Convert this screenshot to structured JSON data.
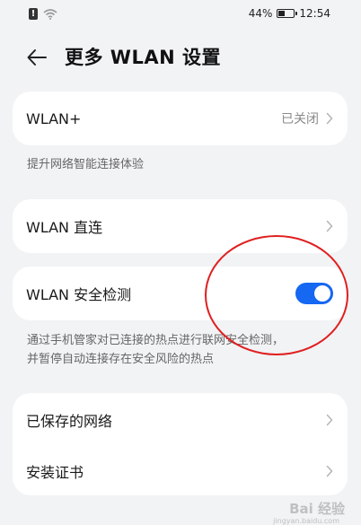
{
  "status_bar": {
    "battery_text": "44%",
    "battery_level": 0.44,
    "time": "12:54"
  },
  "header": {
    "title": "更多 WLAN 设置"
  },
  "sections": {
    "wlan_plus": {
      "label": "WLAN+",
      "value": "已关闭",
      "hint": "提升网络智能连接体验"
    },
    "wlan_direct": {
      "label": "WLAN 直连"
    },
    "security_check": {
      "label": "WLAN 安全检测",
      "enabled": true,
      "hint_line1": "通过手机管家对已连接的热点进行联网安全检测，",
      "hint_line2": "并暂停自动连接存在安全风险的热点"
    },
    "saved_networks": {
      "label": "已保存的网络"
    },
    "install_cert": {
      "label": "安装证书"
    }
  },
  "watermark": {
    "text": "Bai 经验",
    "sub": "jingyan.baidu.com"
  },
  "colors": {
    "background": "#f1f3f5",
    "toggle_on": "#1667f2",
    "annotation": "#e01f1f"
  }
}
